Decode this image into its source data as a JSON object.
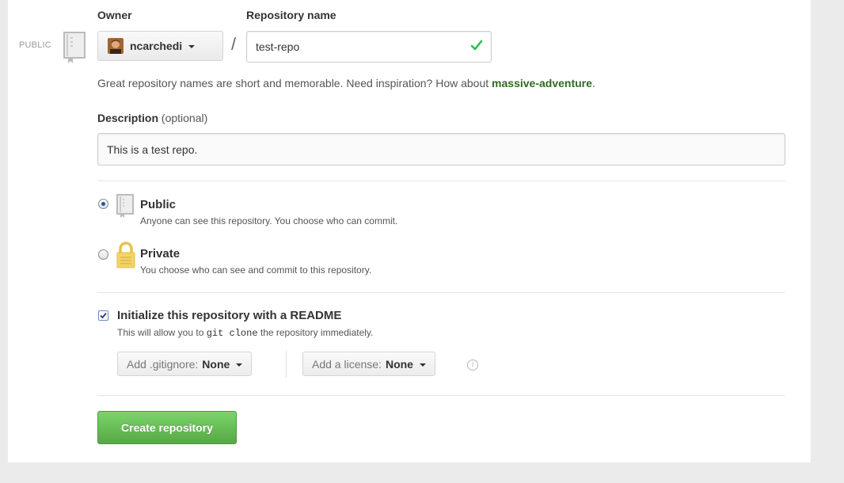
{
  "side": {
    "visibility_label": "PUBLIC"
  },
  "owner": {
    "label": "Owner",
    "name": "ncarchedi"
  },
  "repo": {
    "label": "Repository name",
    "value": "test-repo",
    "separator": "/"
  },
  "hint": {
    "text": "Great repository names are short and memorable. Need inspiration? How about ",
    "suggestion": "massive-adventure",
    "end": "."
  },
  "description": {
    "label": "Description",
    "optional": "(optional)",
    "value": "This is a test repo."
  },
  "visibility": {
    "public": {
      "title": "Public",
      "desc": "Anyone can see this repository. You choose who can commit.",
      "selected": true
    },
    "private": {
      "title": "Private",
      "desc": "You choose who can see and commit to this repository.",
      "selected": false
    }
  },
  "init": {
    "title": "Initialize this repository with a README",
    "desc_before": "This will allow you to ",
    "desc_code": "git clone",
    "desc_after": " the repository immediately.",
    "checked": true
  },
  "gitignore": {
    "label": "Add .gitignore:",
    "value": "None"
  },
  "license": {
    "label": "Add a license:",
    "value": "None"
  },
  "info_icon": "i",
  "submit": {
    "label": "Create repository"
  },
  "colors": {
    "accent_green": "#56a845",
    "suggestion": "#2d6b1f",
    "check": "#2cbe4e"
  }
}
